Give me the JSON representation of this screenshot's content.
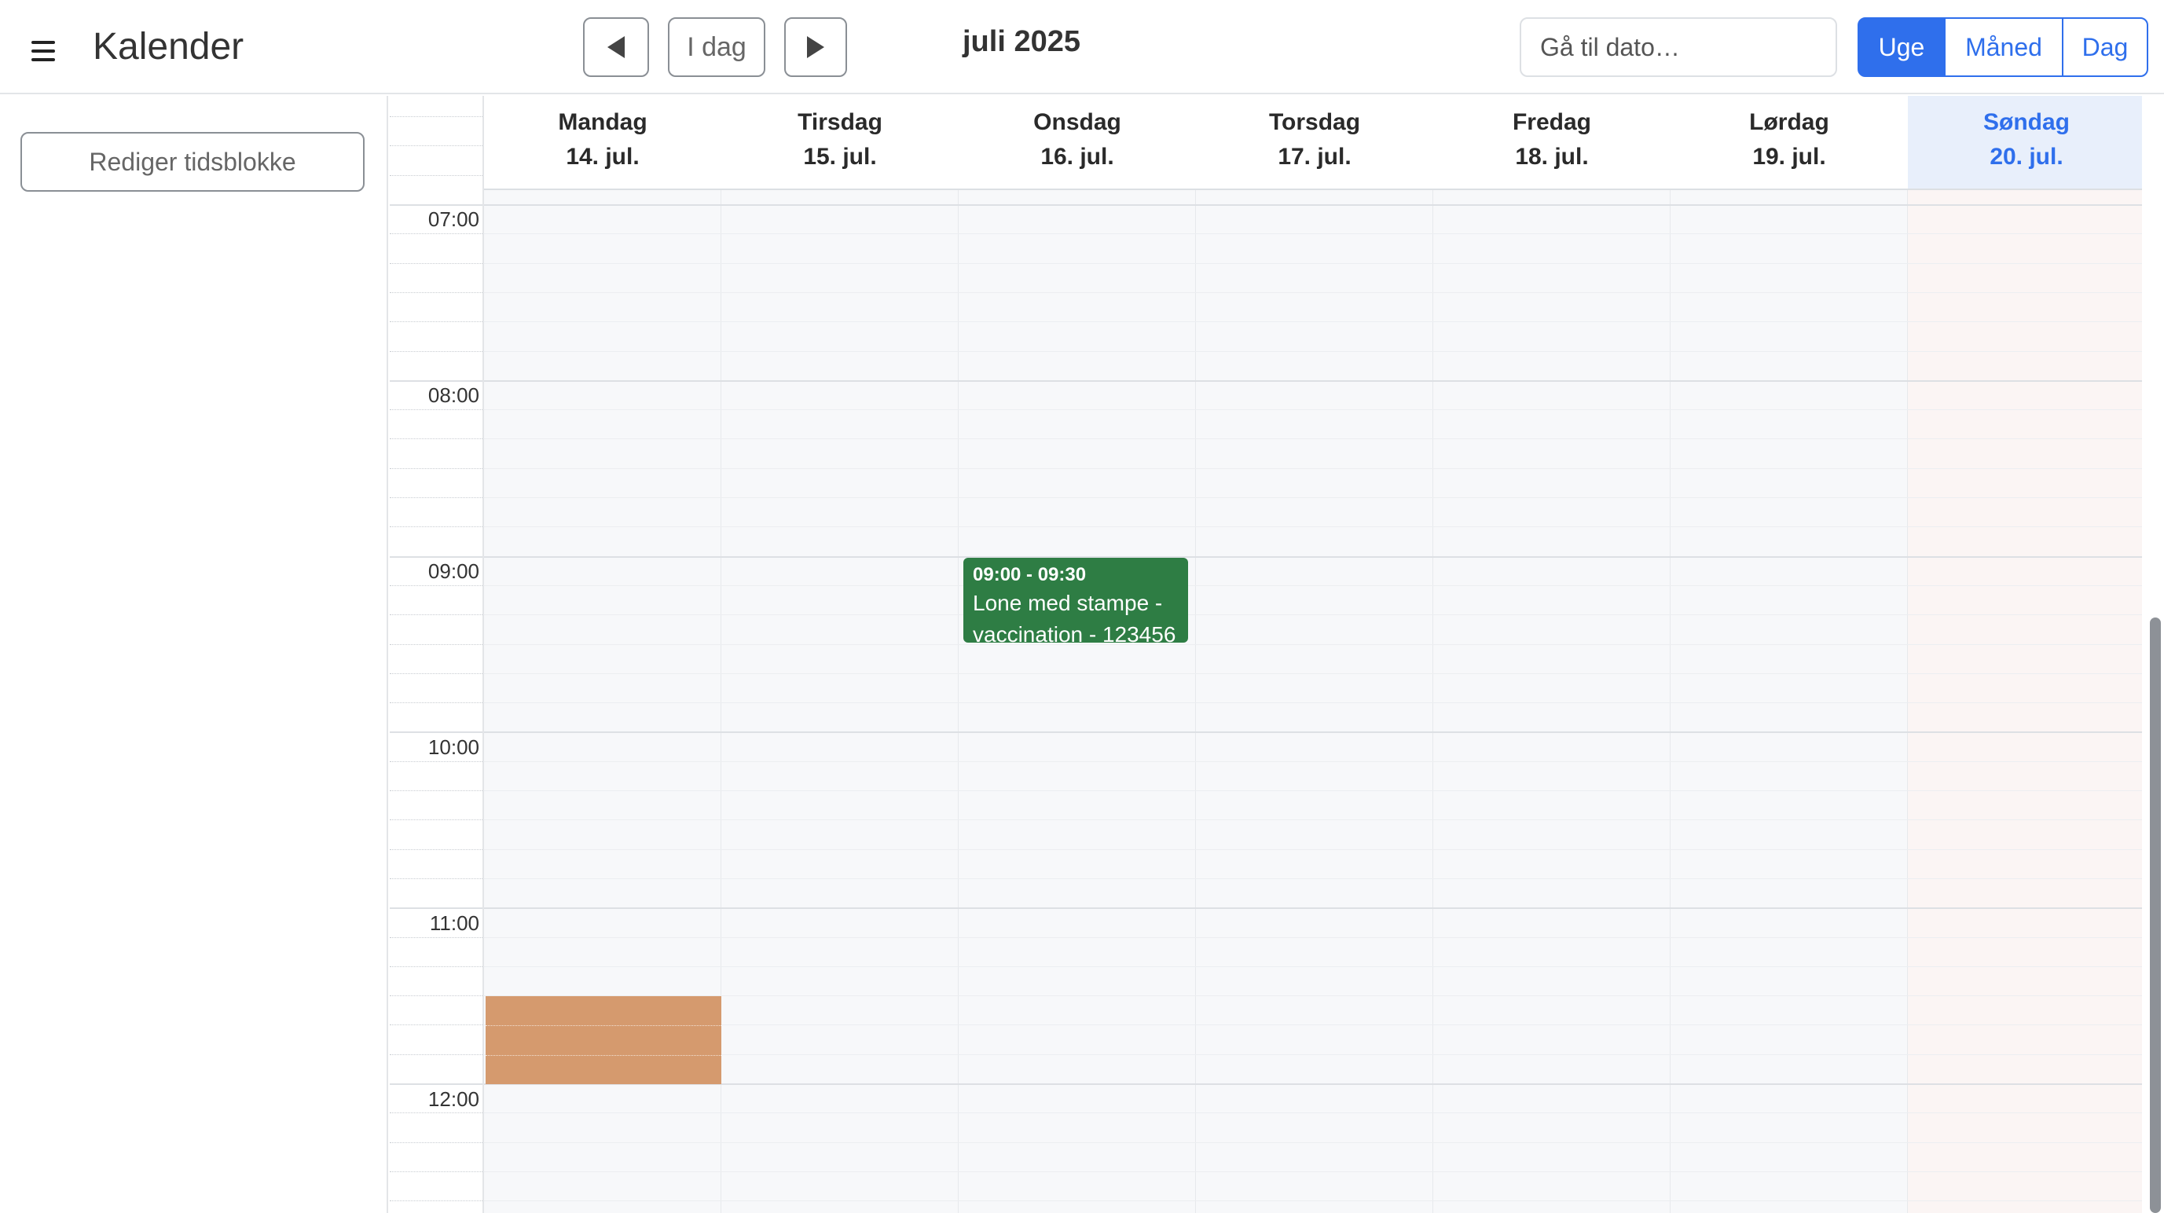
{
  "header": {
    "title": "Kalender",
    "menu_icon": "hamburger-menu-icon",
    "today_label": "I dag",
    "prev_icon": "triangle-left-icon",
    "next_icon": "triangle-right-icon",
    "period": "juli 2025",
    "date_input_placeholder": "Gå til dato…",
    "views": [
      {
        "label": "Uge",
        "active": true
      },
      {
        "label": "Måned",
        "active": false
      },
      {
        "label": "Dag",
        "active": false
      }
    ]
  },
  "sidebar": {
    "edit_blocks_label": "Rediger tidsblokke"
  },
  "calendar": {
    "days": [
      {
        "weekday": "Mandag",
        "date": "14. jul.",
        "today": false
      },
      {
        "weekday": "Tirsdag",
        "date": "15. jul.",
        "today": false
      },
      {
        "weekday": "Onsdag",
        "date": "16. jul.",
        "today": false
      },
      {
        "weekday": "Torsdag",
        "date": "17. jul.",
        "today": false
      },
      {
        "weekday": "Fredag",
        "date": "18. jul.",
        "today": false
      },
      {
        "weekday": "Lørdag",
        "date": "19. jul.",
        "today": false
      },
      {
        "weekday": "Søndag",
        "date": "20. jul.",
        "today": true
      }
    ],
    "hours": [
      "07:00",
      "08:00",
      "09:00",
      "10:00",
      "11:00",
      "12:00"
    ],
    "events": [
      {
        "day_index": 2,
        "start": "09:00",
        "end": "09:30",
        "time_label": "09:00 - 09:30",
        "title": "Lone med stampe - vaccination - 123456",
        "color": "#2e7d44"
      }
    ],
    "blocked_slots": [
      {
        "day_index": 0,
        "start": "11:30",
        "end": "12:00",
        "color": "#d59a6e"
      }
    ]
  },
  "colors": {
    "accent": "#2f6fec",
    "today_header_bg": "#e8effb",
    "today_column_bg": "#fbf5f4",
    "grid_bg": "#f7f8fa"
  }
}
